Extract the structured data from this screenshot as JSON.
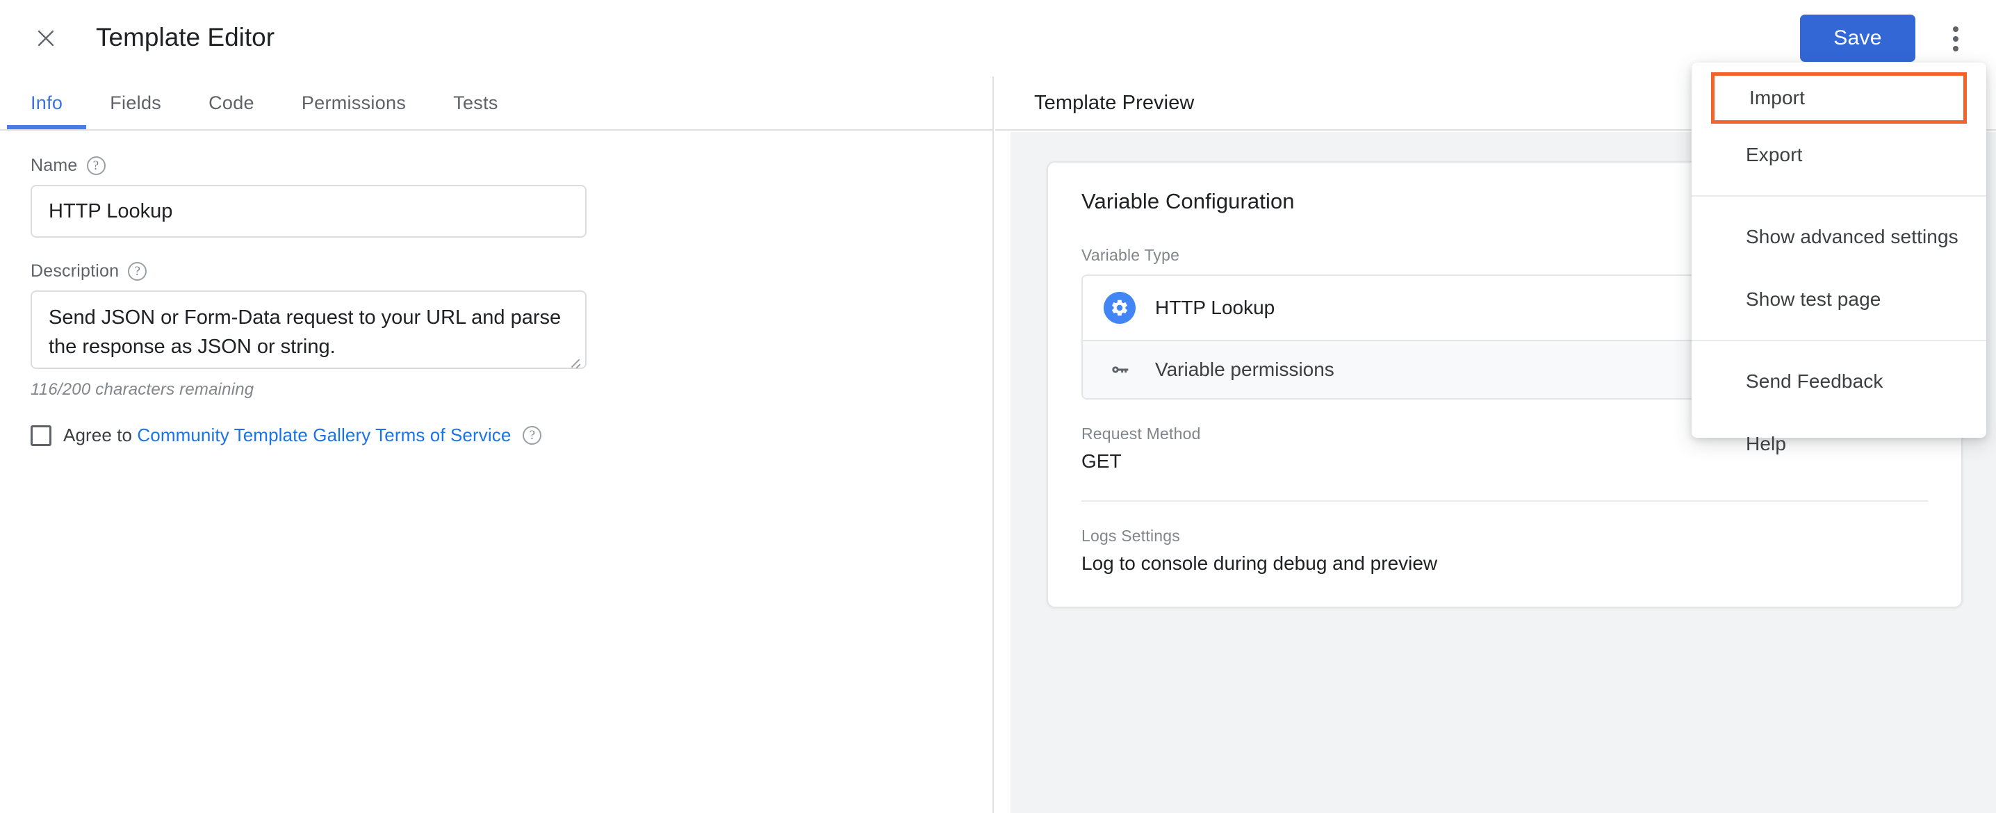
{
  "topbar": {
    "close_label": "close-icon",
    "title": "Template Editor",
    "save_label": "Save",
    "overflow_label": "more-options"
  },
  "tabs": [
    {
      "label": "Info",
      "active": true
    },
    {
      "label": "Fields",
      "active": false
    },
    {
      "label": "Code",
      "active": false
    },
    {
      "label": "Permissions",
      "active": false
    },
    {
      "label": "Tests",
      "active": false
    }
  ],
  "form": {
    "name_label": "Name",
    "name_value": "HTTP Lookup",
    "name_placeholder": "",
    "description_label": "Description",
    "description_value": "Send JSON or Form-Data request to your URL and parse the response as JSON or string.",
    "description_placeholder": "",
    "char_counter": "116/200 characters remaining",
    "agree_prefix": "Agree to ",
    "agree_link": "Community Template Gallery Terms of Service",
    "help_glyph": "?"
  },
  "preview": {
    "header_title": "Template Preview",
    "card_title": "Variable Configuration",
    "variable_type_label": "Variable Type",
    "variable_type_value": "HTTP Lookup",
    "variable_permissions_label": "Variable permissions",
    "request_method_label": "Request Method",
    "request_method_value": "GET",
    "logs_settings_label": "Logs Settings",
    "logs_settings_value": "Log to console during debug and preview"
  },
  "menu": {
    "items": [
      {
        "label": "Import",
        "highlighted": true
      },
      {
        "label": "Export",
        "highlighted": false
      },
      {
        "label": "Show advanced settings",
        "highlighted": false
      },
      {
        "label": "Show test page",
        "highlighted": false
      },
      {
        "label": "Send Feedback",
        "highlighted": false
      },
      {
        "label": "Help",
        "highlighted": false
      }
    ]
  },
  "colors": {
    "accent_blue": "#3367d6",
    "tab_active": "#4a7ce8",
    "link_blue": "#1a73e8",
    "highlight_orange": "#f4642a",
    "preview_bg": "#f1f3f4",
    "gear_badge": "#4285f4"
  }
}
